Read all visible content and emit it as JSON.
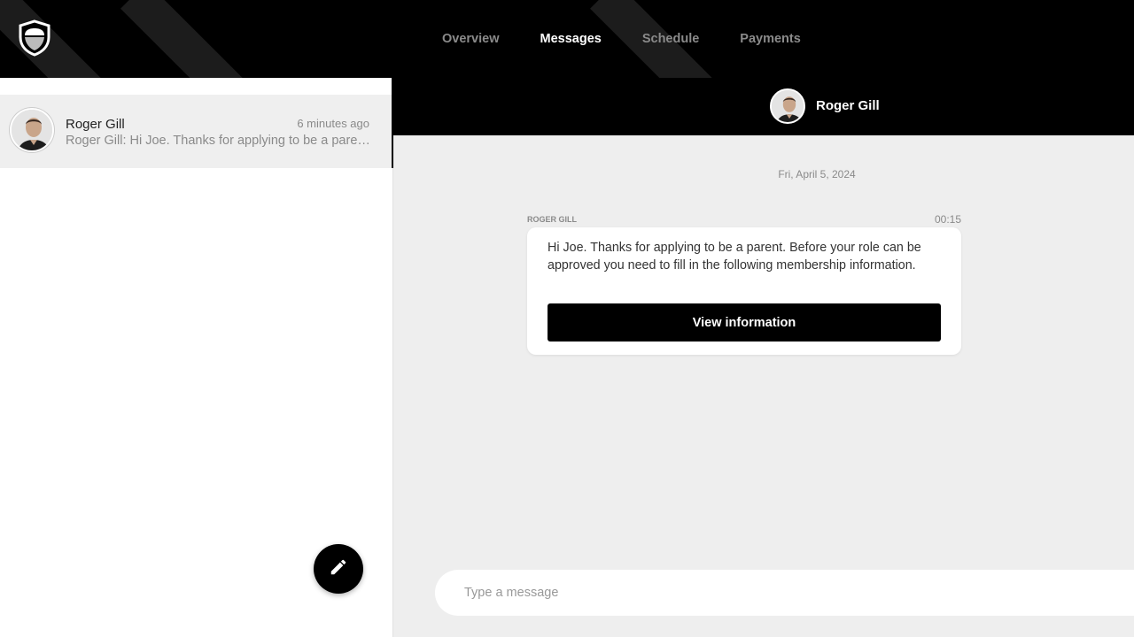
{
  "nav": {
    "items": [
      {
        "label": "Overview",
        "active": false
      },
      {
        "label": "Messages",
        "active": true
      },
      {
        "label": "Schedule",
        "active": false
      },
      {
        "label": "Payments",
        "active": false
      }
    ]
  },
  "conversations": [
    {
      "name": "Roger Gill",
      "time": "6 minutes ago",
      "preview": "Roger Gill: Hi Joe. Thanks for applying to be a parent. Before your role can be approved you need to fill in the following membership information."
    }
  ],
  "chat": {
    "header_name": "Roger Gill",
    "date": "Fri, April 5, 2024",
    "messages": [
      {
        "sender": "ROGER GILL",
        "time": "00:15",
        "text": "Hi Joe. Thanks for applying to be a parent. Before your role can be approved you need to fill in the following membership information.",
        "button_label": "View information"
      }
    ]
  },
  "composer": {
    "placeholder": "Type a message"
  },
  "icons": {
    "logo": "shield-logo-icon",
    "compose": "pencil-icon"
  },
  "colors": {
    "header_bg": "#000000",
    "panel_bg": "#eeeeee",
    "accent": "#000000",
    "muted_text": "#8a8a8a"
  }
}
